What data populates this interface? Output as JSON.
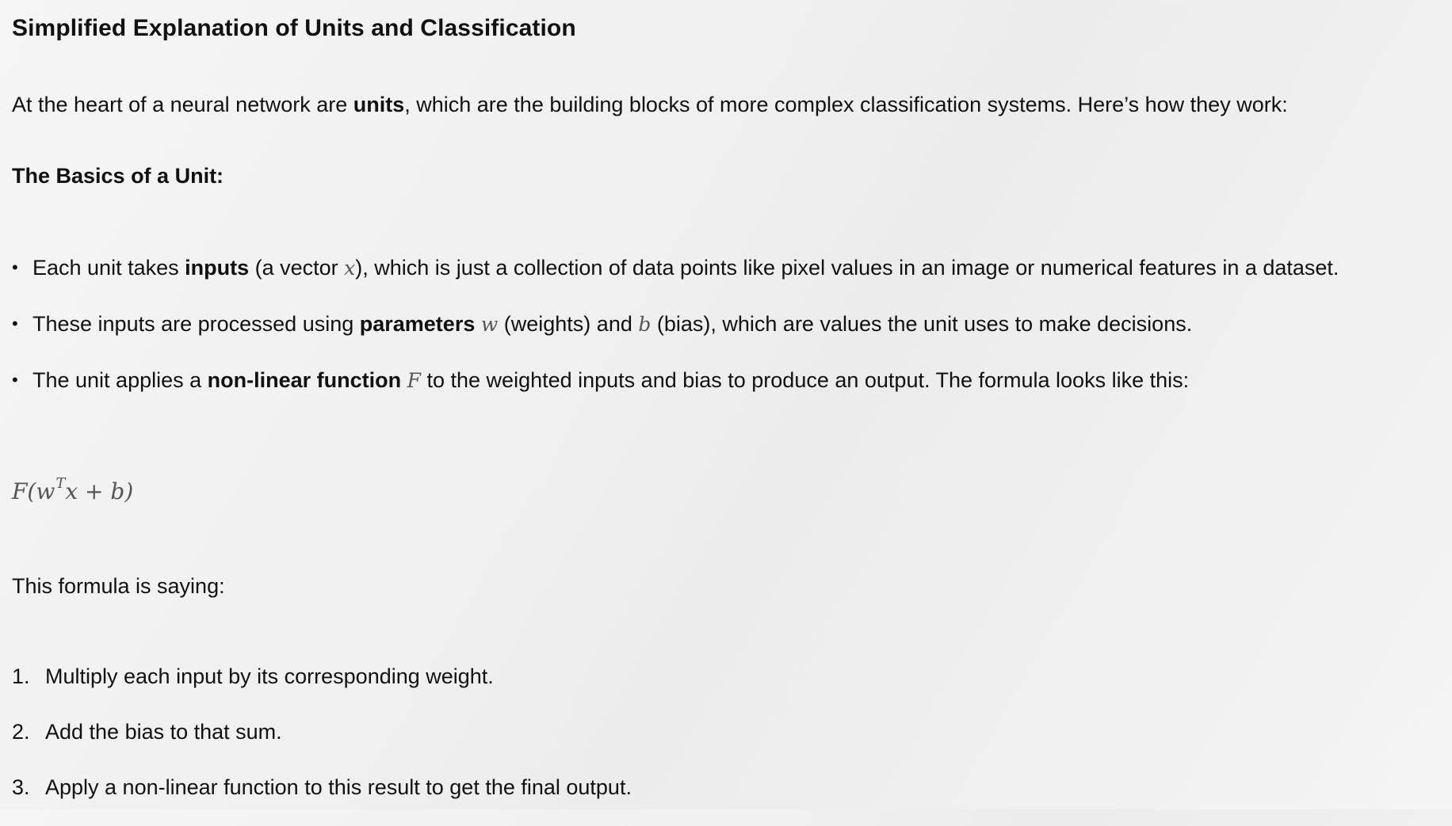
{
  "title": "Simplified Explanation of Units and Classification",
  "intro": {
    "before": "At the heart of a neural network are ",
    "bold": "units",
    "after": ", which are the building blocks of more complex classification systems. Here’s how they work:"
  },
  "subheading": "The Basics of a Unit:",
  "bullets": [
    {
      "marker": "•",
      "before": "Each unit takes ",
      "bold": "inputs",
      "middle": " (a vector ",
      "math": "x",
      "after": "), which is just a collection of data points like pixel values in an image or numerical features in a dataset."
    },
    {
      "marker": "•",
      "before": "These inputs are processed using ",
      "bold": "parameters",
      "math1": "w",
      "middle": " (weights) and ",
      "math2": "b",
      "after": " (bias), which are values the unit uses to make decisions."
    },
    {
      "marker": "•",
      "before": "The unit applies a ",
      "bold": "non-linear function",
      "math": "F",
      "after": " to the weighted inputs and bias to produce an output. The formula looks like this:"
    }
  ],
  "formula": {
    "prefix": "F(w",
    "superscript": "T",
    "suffix": "x + b)"
  },
  "saying": "This formula is saying:",
  "steps": [
    {
      "number": "1.",
      "text": "Multiply each input by its corresponding weight."
    },
    {
      "number": "2.",
      "text": "Add the bias to that sum."
    },
    {
      "number": "3.",
      "text": "Apply a non-linear function to this result to get the final output."
    }
  ]
}
